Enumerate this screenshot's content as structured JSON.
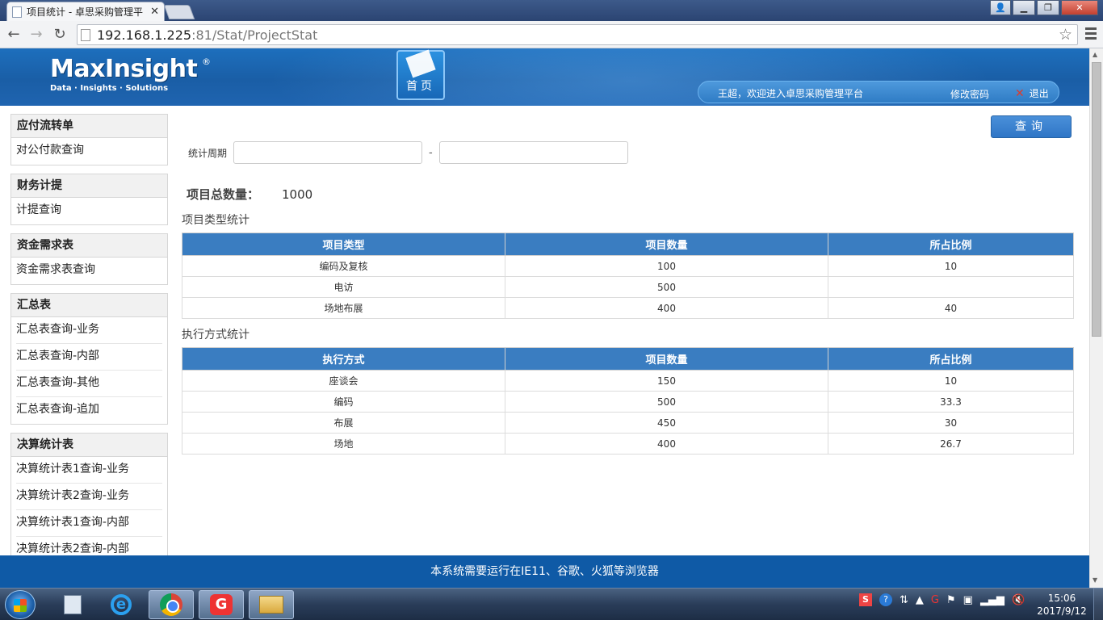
{
  "browser": {
    "tab_title": "项目统计 - 卓思采购管理平",
    "address_host": "192.168.1.225",
    "address_path": ":81/Stat/ProjectStat"
  },
  "header": {
    "logo_name": "MaxInsight",
    "logo_tagline": "Data · Insights · Solutions",
    "logo_reg": "®",
    "home_label": "首页",
    "welcome": "王超，欢迎进入卓思采购管理平台",
    "change_password": "修改密码",
    "logout": "退出"
  },
  "sidebar": {
    "groups": [
      {
        "title": "应付流转单",
        "items": [
          "对公付款查询"
        ]
      },
      {
        "title": "财务计提",
        "items": [
          "计提查询"
        ]
      },
      {
        "title": "资金需求表",
        "items": [
          "资金需求表查询"
        ]
      },
      {
        "title": "汇总表",
        "items": [
          "汇总表查询-业务",
          "汇总表查询-内部",
          "汇总表查询-其他",
          "汇总表查询-追加"
        ]
      },
      {
        "title": "决算统计表",
        "items": [
          "决算统计表1查询-业务",
          "决算统计表2查询-业务",
          "决算统计表1查询-内部",
          "决算统计表2查询-内部"
        ]
      }
    ]
  },
  "main": {
    "query_button": "查询",
    "period_label": "统计周期",
    "period_start": "",
    "period_end": "",
    "period_sep": "-",
    "total_label": "项目总数量：",
    "total_value": "1000",
    "type_section_title": "项目类型统计",
    "type_table": {
      "headers": [
        "项目类型",
        "项目数量",
        "所占比例"
      ],
      "rows": [
        [
          "编码及复核",
          "100",
          "10"
        ],
        [
          "电访",
          "500",
          ""
        ],
        [
          "场地布展",
          "400",
          "40"
        ]
      ]
    },
    "method_section_title": "执行方式统计",
    "method_table": {
      "headers": [
        "执行方式",
        "项目数量",
        "所占比例"
      ],
      "rows": [
        [
          "座谈会",
          "150",
          "10"
        ],
        [
          "编码",
          "500",
          "33.3"
        ],
        [
          "布展",
          "450",
          "30"
        ],
        [
          "场地",
          "400",
          "26.7"
        ]
      ]
    }
  },
  "footer": {
    "text": "本系统需要运行在IE11、谷歌、火狐等浏览器"
  },
  "taskbar": {
    "time": "15:06",
    "date": "2017/9/12"
  },
  "colors": {
    "header_blue": "#1a5ea6",
    "table_header": "#3a7dc1",
    "footer": "#0f5aa6"
  }
}
